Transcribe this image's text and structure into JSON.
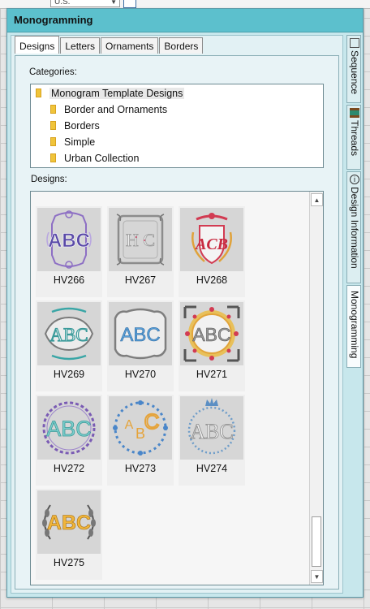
{
  "window": {
    "title": "Monogramming"
  },
  "topbar": {
    "dropdown_value": "U.S."
  },
  "tabs": [
    {
      "label": "Designs",
      "active": true
    },
    {
      "label": "Letters"
    },
    {
      "label": "Ornaments"
    },
    {
      "label": "Borders"
    }
  ],
  "categories": {
    "label": "Categories:",
    "items": [
      {
        "label": "Monogram Template Designs",
        "selected": true
      },
      {
        "label": "Border and Ornaments"
      },
      {
        "label": "Borders"
      },
      {
        "label": "Simple"
      },
      {
        "label": "Urban Collection"
      }
    ]
  },
  "designs": {
    "label": "Designs:",
    "items": [
      {
        "name": "HV266",
        "icon": "monogram-abc-purple-scroll-icon"
      },
      {
        "name": "HV267",
        "icon": "monogram-frame-grey-icon"
      },
      {
        "name": "HV268",
        "icon": "monogram-crest-red-icon"
      },
      {
        "name": "HV269",
        "icon": "monogram-ornate-teal-icon"
      },
      {
        "name": "HV270",
        "icon": "monogram-frame-blue-icon"
      },
      {
        "name": "HV271",
        "icon": "monogram-scallop-orange-icon"
      },
      {
        "name": "HV272",
        "icon": "monogram-wreath-purple-icon"
      },
      {
        "name": "HV273",
        "icon": "monogram-wreath-blue-orange-icon"
      },
      {
        "name": "HV274",
        "icon": "monogram-wreath-crown-icon"
      },
      {
        "name": "HV275",
        "icon": "monogram-laurel-orange-icon"
      }
    ]
  },
  "sidebar_tabs": [
    {
      "label": "Sequence"
    },
    {
      "label": "Threads"
    },
    {
      "label": "Design Information"
    },
    {
      "label": "Monogramming",
      "active": true
    }
  ],
  "colors": {
    "titlebar": "#5cc0cd",
    "panel": "#c7e7ec",
    "folder": "#f0c43a"
  }
}
